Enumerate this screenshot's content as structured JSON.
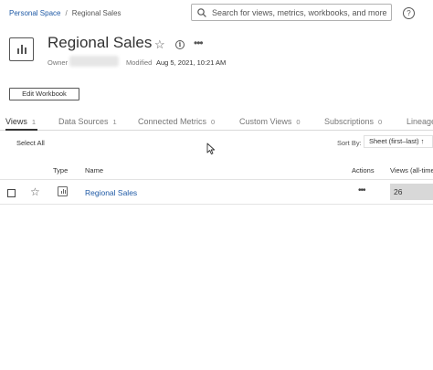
{
  "breadcrumb": {
    "parent": "Personal Space",
    "separator": "/",
    "current": "Regional Sales"
  },
  "search": {
    "placeholder": "Search for views, metrics, workbooks, and more",
    "value": ""
  },
  "header": {
    "help_symbol": "?",
    "title": "Regional Sales",
    "star_symbol": "☆",
    "info_symbol": "i",
    "more_symbol": "•••",
    "owner_label": "Owner",
    "modified_label": "Modified",
    "modified_value": "Aug 5, 2021, 10:21 AM"
  },
  "toolbar": {
    "edit_workbook_label": "Edit Workbook"
  },
  "tabs": [
    {
      "label": "Views",
      "count": "1"
    },
    {
      "label": "Data Sources",
      "count": "1"
    },
    {
      "label": "Connected Metrics",
      "count": "0"
    },
    {
      "label": "Custom Views",
      "count": "0"
    },
    {
      "label": "Subscriptions",
      "count": "0"
    },
    {
      "label": "Lineage",
      "count": ""
    }
  ],
  "controls": {
    "select_all_label": "Select All",
    "sort_by_label": "Sort By:",
    "sort_by_value": "Sheet (first–last) ↑"
  },
  "table": {
    "columns": {
      "type": "Type",
      "name": "Name",
      "actions": "Actions",
      "views": "Views (all-time)"
    },
    "rows": [
      {
        "name": "Regional Sales",
        "star_symbol": "☆",
        "actions_symbol": "•••",
        "views": "26"
      }
    ]
  },
  "icons": {
    "search": "search-icon",
    "help": "help-icon",
    "workbook": "workbook-thumbnail-icon",
    "favorite": "star-icon",
    "info": "info-icon",
    "more": "more-actions-icon",
    "view_type": "sheet-icon",
    "cursor": "mouse-cursor-icon"
  },
  "colors": {
    "link": "#1f5aa6",
    "text": "#333333",
    "muted": "#777777",
    "views_cell_bg": "#d8d8d8"
  }
}
